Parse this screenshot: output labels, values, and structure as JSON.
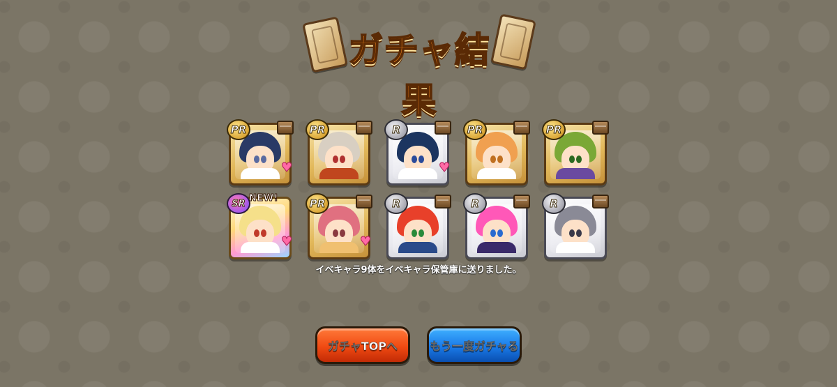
{
  "title": "ガチャ結果",
  "cards": [
    {
      "rarity": "PR",
      "type": "pr",
      "hair": "#2a3a66",
      "skin": "#fde1c8",
      "eye": "#5a6aa0",
      "outfit": "#ffffff",
      "heart": true,
      "new": false
    },
    {
      "rarity": "PR",
      "type": "pr",
      "hair": "#d8cfc2",
      "skin": "#fde1c8",
      "eye": "#b03030",
      "outfit": "#c0461e",
      "heart": false,
      "new": false
    },
    {
      "rarity": "R",
      "type": "r",
      "hair": "#1c3560",
      "skin": "#fde1c8",
      "eye": "#2a4a9a",
      "outfit": "#ffffff",
      "heart": true,
      "new": false
    },
    {
      "rarity": "PR",
      "type": "pr",
      "hair": "#f0a050",
      "skin": "#fde1c8",
      "eye": "#c07020",
      "outfit": "#ffffff",
      "heart": false,
      "new": false
    },
    {
      "rarity": "PR",
      "type": "pr",
      "hair": "#7aa836",
      "skin": "#fde1c8",
      "eye": "#2a6a20",
      "outfit": "#6a4aa0",
      "heart": false,
      "new": false
    },
    {
      "rarity": "SR",
      "type": "sr",
      "hair": "#f5e08a",
      "skin": "#fde1c8",
      "eye": "#c03a2a",
      "outfit": "#ffffff",
      "heart": true,
      "new": true,
      "new_label": "NEW!"
    },
    {
      "rarity": "PR",
      "type": "pr",
      "hair": "#e07080",
      "skin": "#fde1c8",
      "eye": "#8a3a40",
      "outfit": "#f0c070",
      "heart": true,
      "new": false
    },
    {
      "rarity": "R",
      "type": "r",
      "hair": "#e8402a",
      "skin": "#fde1c8",
      "eye": "#2a8a3a",
      "outfit": "#2a4a8a",
      "heart": false,
      "new": false
    },
    {
      "rarity": "R",
      "type": "r",
      "hair": "#ff58b8",
      "skin": "#fde1c8",
      "eye": "#2a6ad0",
      "outfit": "#3a2a6a",
      "heart": false,
      "new": false
    },
    {
      "rarity": "R",
      "type": "r",
      "hair": "#8a8a96",
      "skin": "#fde1c8",
      "eye": "#3a3a4a",
      "outfit": "#ffffff",
      "heart": false,
      "new": false
    }
  ],
  "message": "イベキャラ9体をイベキャラ保管庫に送りました。",
  "buttons": {
    "top": "ガチャTOPへ",
    "again": "もう一度ガチャる"
  }
}
